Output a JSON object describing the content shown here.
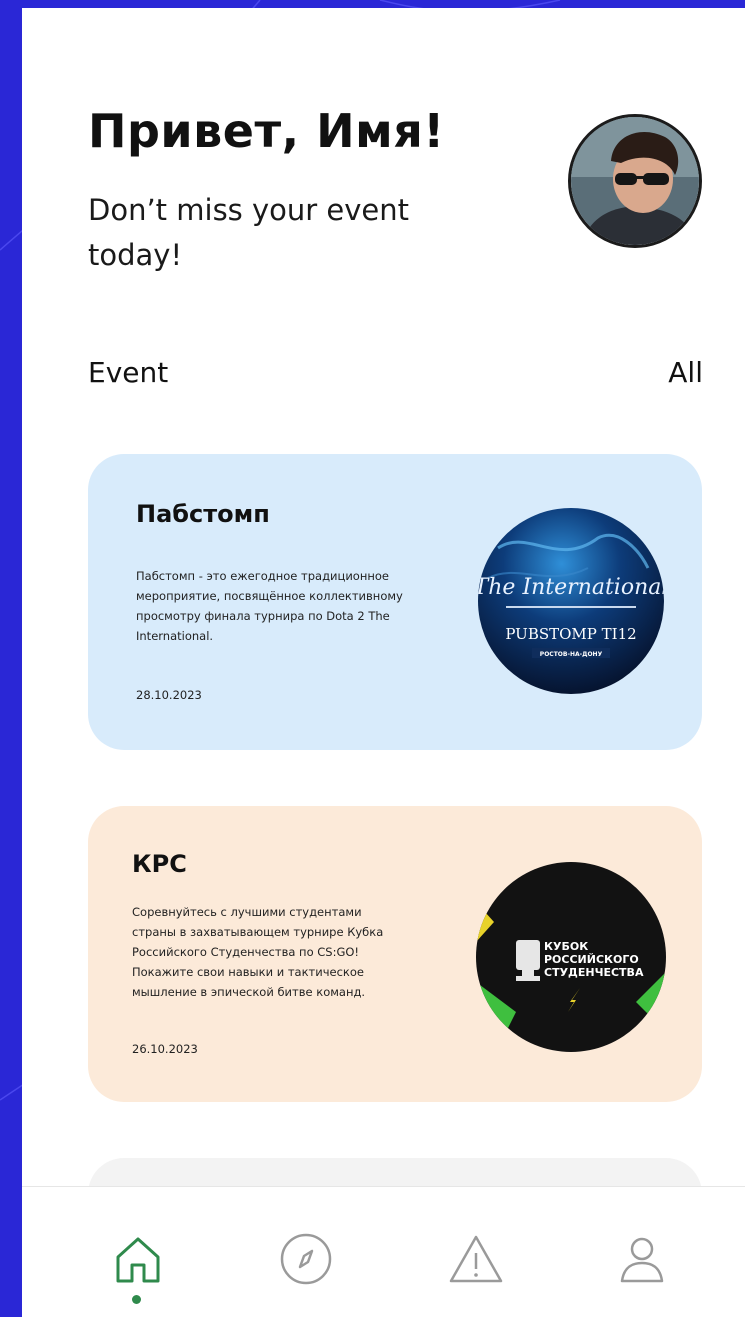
{
  "header": {
    "greeting": "Привет, Имя!",
    "subtitle": "Don’t miss your event today!",
    "avatar_icon": "user-avatar-photo"
  },
  "section": {
    "title": "Event",
    "all_label": "All"
  },
  "events": [
    {
      "title": "Пабстомп",
      "description": "Пабстомп - это ежегодное традиционное мероприятие, посвящённое коллективному просмотру финала турнира по Dota 2 The International.",
      "date": "28.10.2023",
      "image": {
        "script_title": "The International",
        "banner": "PUBSTOMP TI12",
        "caption": "РОСТОВ-НА-ДОНУ"
      },
      "background": "#d8ebfb"
    },
    {
      "title": "КРС",
      "description": "Соревнуйтесь с лучшими студентами страны в захватывающем турнире Кубка Российского Студенчества по CS:GO! Покажите свои навыки и тактическое мышление в эпической битве команд.",
      "date": "26.10.2023",
      "image": {
        "line1": "КУБОК",
        "line2": "РОССИЙСКОГО",
        "line3": "СТУДЕНЧЕСТВА"
      },
      "background": "#fcead9"
    }
  ],
  "tabbar": {
    "items": [
      {
        "icon": "home-icon",
        "active": true
      },
      {
        "icon": "compass-icon",
        "active": false
      },
      {
        "icon": "warning-icon",
        "active": false
      },
      {
        "icon": "profile-icon",
        "active": false
      }
    ],
    "active_color": "#2f8a4c",
    "inactive_color": "#9a9a9a"
  },
  "colors": {
    "outer_background": "#2a27d6",
    "card1": "#d8ebfb",
    "card2": "#fcead9"
  }
}
